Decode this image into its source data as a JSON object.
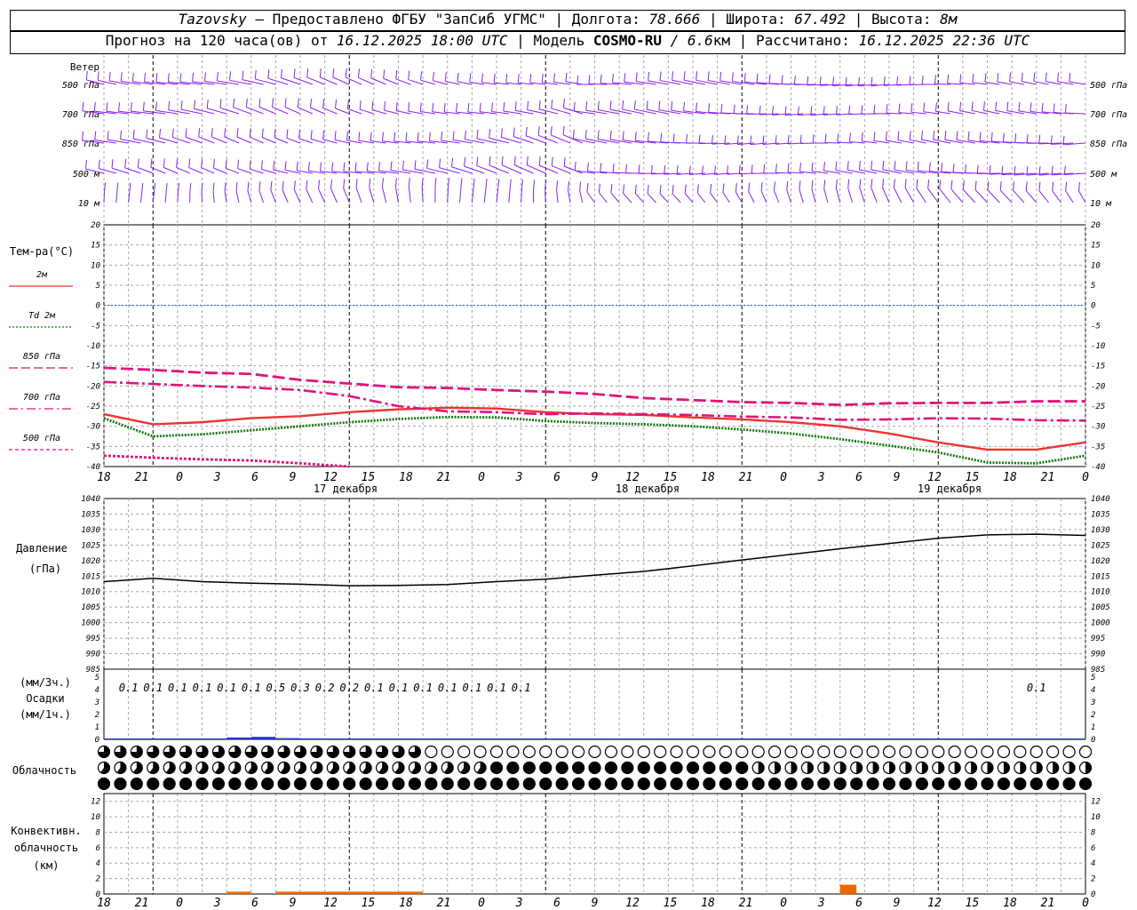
{
  "header": {
    "station": "Tazovsky",
    "dash": "—",
    "provider": "Предоставлено ФГБУ \"ЗапСиб УГМС\"",
    "lon_label": "Долгота:",
    "lon_value": "78.666",
    "lat_label": "Широта:",
    "lat_value": "67.492",
    "alt_label": "Высота:",
    "alt_value": "8м",
    "forecast_prefix": "Прогноз на 120 часа(ов) от",
    "forecast_start": "16.12.2025 18:00 UTC",
    "model_label": "Модель",
    "model_name": "COSMO-RU",
    "model_res_prefix": "/ 6.6",
    "model_res_unit": "км",
    "computed_label": "Рассчитано:",
    "computed_value": "16.12.2025 22:36 UTC",
    "sep": "|"
  },
  "colors": {
    "t2m": "#ee3333",
    "td2m": "#117711",
    "t850": "#e0147a",
    "t700": "#e0147a",
    "t500": "#e0147a",
    "wind": "#8822ee",
    "zero_line": "#3355cc",
    "pressure": "#000000",
    "precip": "#2233cc",
    "convective": "#ee6600",
    "grid": "#aaaaaa"
  },
  "time_axis": {
    "hours": [
      "18",
      "21",
      "0",
      "3",
      "6",
      "9",
      "12",
      "15",
      "18",
      "21",
      "0",
      "3",
      "6",
      "9",
      "12",
      "15",
      "18",
      "21",
      "0",
      "3",
      "6",
      "9",
      "12",
      "15",
      "18",
      "21",
      "0"
    ],
    "days": [
      "17 декабря",
      "18 декабря",
      "19 декабря"
    ]
  },
  "wind_panel": {
    "title": "Ветер",
    "levels": [
      "500 гПа",
      "700 гПа",
      "850 гПа",
      "500 м",
      "10  м"
    ]
  },
  "temp_panel": {
    "title": "Тем-ра(°C)",
    "legend": [
      {
        "label": "2м",
        "style": "solid",
        "color": "#ee3333"
      },
      {
        "label": "Td  2м",
        "style": "dotted",
        "color": "#117711"
      },
      {
        "label": "850 гПа",
        "style": "dashed",
        "color": "#e0147a"
      },
      {
        "label": "700 гПа",
        "style": "dashdot",
        "color": "#e0147a"
      },
      {
        "label": "500 гПа",
        "style": "fine-dash",
        "color": "#e0147a"
      }
    ],
    "ticks": [
      "20",
      "15",
      "10",
      "5",
      "0",
      "-5",
      "-10",
      "-15",
      "-20",
      "-25",
      "-30",
      "-35",
      "-40"
    ]
  },
  "pressure_panel": {
    "title": "Давление",
    "unit": "(гПа)",
    "ticks": [
      "1040",
      "1035",
      "1030",
      "1025",
      "1020",
      "1015",
      "1010",
      "1005",
      "1000",
      "995",
      "990",
      "985"
    ]
  },
  "precip_panel": {
    "unit_3h": "(мм/3ч.)",
    "title": "Осадки",
    "unit_1h": "(мм/1ч.)",
    "ticks": [
      "5",
      "4",
      "3",
      "2",
      "1",
      "0"
    ],
    "labels": [
      {
        "h": 3,
        "v": "0.1"
      },
      {
        "h": 6,
        "v": "0.1"
      },
      {
        "h": 9,
        "v": "0.1"
      },
      {
        "h": 12,
        "v": "0.1"
      },
      {
        "h": 15,
        "v": "0.1"
      },
      {
        "h": 18,
        "v": "0.1"
      },
      {
        "h": 21,
        "v": "0.5"
      },
      {
        "h": 24,
        "v": "0.3"
      },
      {
        "h": 27,
        "v": "0.2"
      },
      {
        "h": 30,
        "v": "0.2"
      },
      {
        "h": 33,
        "v": "0.1"
      },
      {
        "h": 36,
        "v": "0.1"
      },
      {
        "h": 39,
        "v": "0.1"
      },
      {
        "h": 42,
        "v": "0.1"
      },
      {
        "h": 45,
        "v": "0.1"
      },
      {
        "h": 48,
        "v": "0.1"
      },
      {
        "h": 51,
        "v": "0.1"
      },
      {
        "h": 114,
        "v": "0.1"
      }
    ]
  },
  "cloud_panel": {
    "title": "Облачность"
  },
  "conv_panel": {
    "title1": "Конвективн.",
    "title2": "облачность",
    "unit": "(км)",
    "ticks": [
      "12",
      "10",
      "8",
      "6",
      "4",
      "2",
      "0"
    ]
  },
  "chart_data": [
    {
      "type": "line",
      "name": "temperature",
      "x_hours": [
        0,
        6,
        12,
        18,
        24,
        30,
        36,
        42,
        48,
        54,
        60,
        66,
        72,
        78,
        84,
        90,
        96,
        102,
        108,
        114,
        120
      ],
      "series": [
        {
          "name": "2м",
          "values": [
            -27,
            -29.5,
            -29,
            -28,
            -27.5,
            -26.5,
            -25.8,
            -25.4,
            -25.6,
            -26.5,
            -27,
            -27.2,
            -27.8,
            -28.3,
            -29,
            -30,
            -31.8,
            -34,
            -35.8,
            -35.8,
            -34
          ]
        },
        {
          "name": "Td  2м",
          "values": [
            -28,
            -32.5,
            -32,
            -31,
            -30,
            -29,
            -28.2,
            -27.7,
            -27.8,
            -28.7,
            -29.2,
            -29.5,
            -30,
            -30.8,
            -31.8,
            -33.2,
            -34.8,
            -36.5,
            -39,
            -39.2,
            -37.3
          ]
        },
        {
          "name": "850 гПа",
          "values": [
            -15.5,
            -16,
            -16.7,
            -17,
            -18.5,
            -19.4,
            -20.3,
            -20.5,
            -21,
            -21.4,
            -22,
            -23,
            -23.5,
            -24,
            -24.2,
            -24.7,
            -24.3,
            -24.2,
            -24.2,
            -23.8,
            -23.8
          ]
        },
        {
          "name": "700 гПа",
          "values": [
            -19,
            -19.5,
            -20,
            -20.4,
            -21,
            -22.5,
            -25,
            -26.3,
            -26.5,
            -27,
            -26.8,
            -27,
            -27.2,
            -27.6,
            -27.8,
            -28.4,
            -28.3,
            -28,
            -28.1,
            -28.5,
            -28.6
          ]
        },
        {
          "name": "500 гПа",
          "values": [
            -37.3,
            -37.8,
            -38.2,
            -38.5,
            -39.2,
            -40,
            null,
            null,
            null,
            null,
            null,
            null,
            null,
            null,
            null,
            null,
            null,
            null,
            null,
            null,
            null
          ]
        }
      ],
      "ylim": [
        -40,
        20
      ]
    },
    {
      "type": "line",
      "name": "pressure",
      "x_hours": [
        0,
        6,
        12,
        18,
        24,
        30,
        36,
        42,
        48,
        54,
        60,
        66,
        72,
        78,
        84,
        90,
        96,
        102,
        108,
        114,
        120
      ],
      "series": [
        {
          "name": "Давление",
          "values": [
            1013.2,
            1014.3,
            1013.2,
            1012.7,
            1012.4,
            1011.9,
            1012,
            1012.3,
            1013.2,
            1014,
            1015.3,
            1016.5,
            1018.3,
            1020.2,
            1022,
            1023.8,
            1025.5,
            1027.2,
            1028.3,
            1028.5,
            1028.1
          ]
        }
      ],
      "ylim": [
        985,
        1040
      ]
    },
    {
      "type": "bar",
      "name": "precipitation",
      "x_hours": [
        3,
        6,
        9,
        12,
        15,
        18,
        21,
        24,
        27,
        30,
        33,
        36,
        39,
        42,
        45,
        48,
        51,
        54,
        57,
        60,
        63,
        66,
        69,
        72,
        75,
        78,
        81,
        84,
        87,
        90,
        93,
        96,
        99,
        102,
        105,
        108,
        111,
        114,
        117,
        120
      ],
      "values": [
        0.05,
        0.03,
        0.05,
        0.06,
        0.07,
        0.15,
        0.2,
        0.1,
        0.08,
        0.07,
        0.05,
        0.05,
        0.07,
        0.05,
        0.03,
        0.02,
        0.02,
        0.01,
        0.01,
        0.01,
        0.01,
        0.01,
        0.01,
        0.01,
        0.01,
        0.01,
        0.01,
        0.01,
        0.01,
        0.01,
        0.01,
        0.01,
        0.02,
        0.01,
        0.01,
        0.01,
        0.01,
        0.02,
        0.02,
        0.02
      ],
      "ylim": [
        0,
        5
      ]
    },
    {
      "type": "bar",
      "name": "convective",
      "segments": [
        {
          "from_h": 15,
          "to_h": 18,
          "top_km": 0.3
        },
        {
          "from_h": 21,
          "to_h": 24,
          "top_km": 0.3
        },
        {
          "from_h": 24,
          "to_h": 39,
          "top_km": 0.3
        },
        {
          "from_h": 90,
          "to_h": 92,
          "top_km": 1.2
        }
      ],
      "ylim": [
        0,
        13
      ]
    }
  ]
}
